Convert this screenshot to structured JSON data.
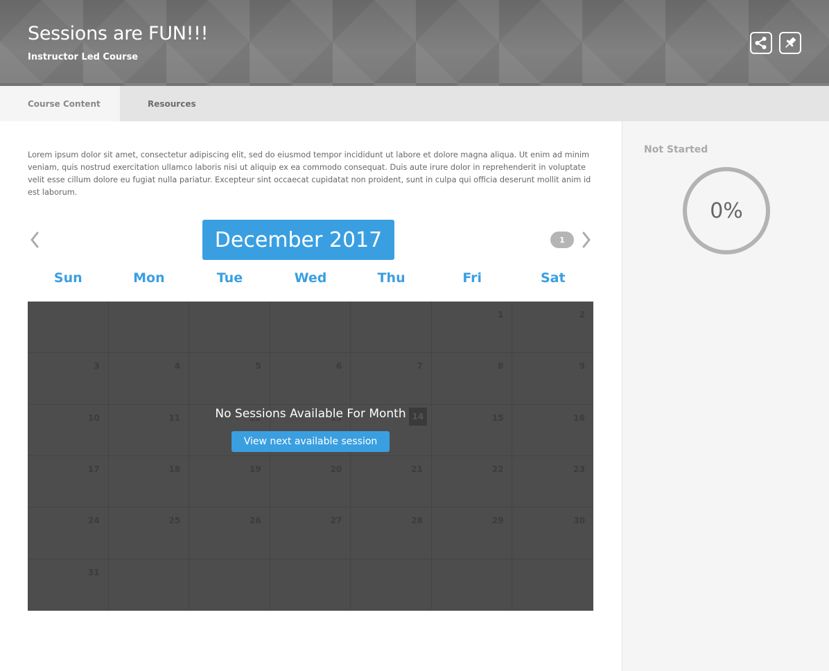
{
  "header": {
    "title": "Sessions are FUN!!!",
    "subtitle": "Instructor Led Course",
    "share_icon": "share-icon",
    "pin_icon": "pin-icon"
  },
  "tabs": [
    {
      "label": "Course Content",
      "active": true
    },
    {
      "label": "Resources",
      "active": false
    }
  ],
  "description": "Lorem ipsum dolor sit amet, consectetur adipiscing elit, sed do eiusmod tempor incididunt ut labore et dolore magna aliqua. Ut enim ad minim veniam, quis nostrud exercitation ullamco laboris nisi ut aliquip ex ea commodo consequat. Duis aute irure dolor in reprehenderit in voluptate velit esse cillum dolore eu fugiat nulla pariatur. Excepteur sint occaecat cupidatat non proident, sunt in culpa qui officia deserunt mollit anim id est laborum.",
  "calendar": {
    "month_label": "December 2017",
    "count_badge": "1",
    "weekdays": [
      "Sun",
      "Mon",
      "Tue",
      "Wed",
      "Thu",
      "Fri",
      "Sat"
    ],
    "first_weekday_index": 5,
    "days_in_month": 31,
    "highlight_day": 14,
    "no_sessions_message": "No Sessions Available For Month",
    "next_session_label": "View next available session"
  },
  "sidebar": {
    "status_label": "Not Started",
    "progress_value": 0,
    "progress_text": "0%"
  },
  "colors": {
    "accent": "#3a9fe1",
    "calendar_bg": "#4d4d4d",
    "ring": "#b3b3b3"
  }
}
